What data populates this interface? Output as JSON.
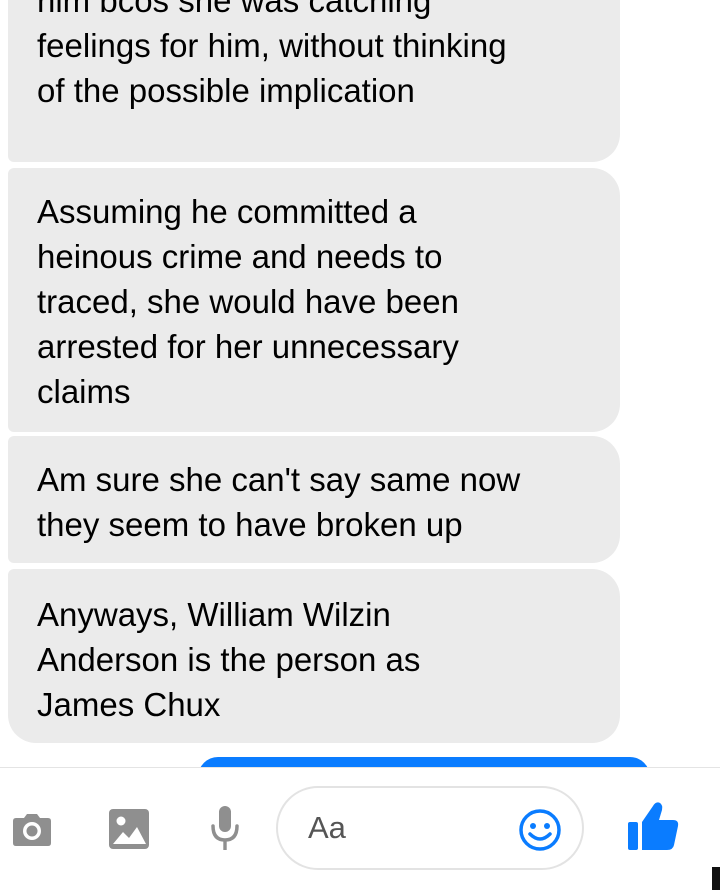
{
  "messages": [
    {
      "lines": [
        "him bcos she was catching",
        "feelings for him, without thinking",
        "of the possible implication"
      ]
    },
    {
      "lines": [
        "Assuming he committed a",
        "heinous crime and needs to",
        "traced, she would have been",
        "arrested for her unnecessary",
        "claims"
      ]
    },
    {
      "lines": [
        "Am sure she can't say same now",
        "they seem to have broken up"
      ]
    },
    {
      "lines": [
        "Anyways, William Wilzin",
        "Anderson is the person as",
        "James Chux"
      ]
    }
  ],
  "composer": {
    "placeholder": "Aa",
    "icons": [
      "camera-icon",
      "image-icon",
      "mic-icon",
      "emoji-icon",
      "like-icon"
    ]
  },
  "colors": {
    "incoming_bubble": "#ebebeb",
    "accent": "#0a7cff"
  }
}
